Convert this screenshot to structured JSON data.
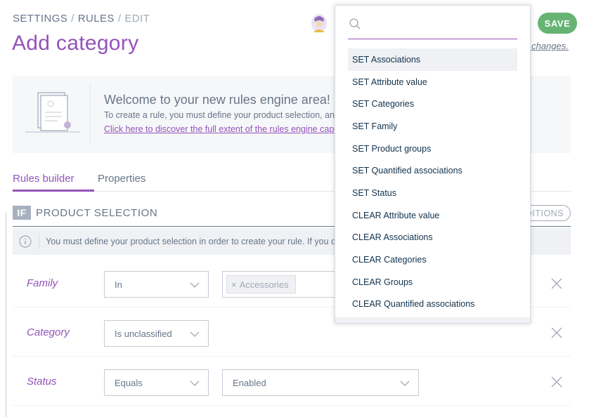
{
  "header": {
    "breadcrumb": [
      "SETTINGS",
      "RULES",
      "EDIT"
    ],
    "breadcrumb_separator": "/",
    "title": "Add category",
    "save_label": "SAVE",
    "unsaved_text": "ed changes."
  },
  "helper": {
    "title": "Welcome to your new rules engine area!",
    "text": "To create a rule, you must define your product selection, and t",
    "link": "Click here to discover the full extent of the rules engine capab"
  },
  "tabs": [
    {
      "label": "Rules builder",
      "active": true
    },
    {
      "label": "Properties",
      "active": false
    }
  ],
  "section": {
    "badge": "IF",
    "title": "PRODUCT SELECTION",
    "add_conditions_label": "DITIONS",
    "info_text": "You must define your product selection in order to create your rule. If you don"
  },
  "conditions": [
    {
      "field": "Family",
      "operator": "In",
      "value_chip": "Accessories"
    },
    {
      "field": "Category",
      "operator": "Is unclassified"
    },
    {
      "field": "Status",
      "operator": "Equals",
      "value": "Enabled"
    }
  ],
  "dropdown": {
    "search_placeholder": "",
    "items": [
      "SET Associations",
      "SET Attribute value",
      "SET Categories",
      "SET Family",
      "SET Product groups",
      "SET Quantified associations",
      "SET Status",
      "CLEAR Attribute value",
      "CLEAR Associations",
      "CLEAR Categories",
      "CLEAR Groups",
      "CLEAR Quantified associations"
    ],
    "highlighted_index": 0
  },
  "colors": {
    "accent": "#9452ba",
    "save": "#67b373",
    "text": "#67768a",
    "muted": "#a1a9b7"
  },
  "icons": [
    "avatar",
    "info-icon",
    "chevron-down-icon",
    "close-icon",
    "search-icon"
  ]
}
